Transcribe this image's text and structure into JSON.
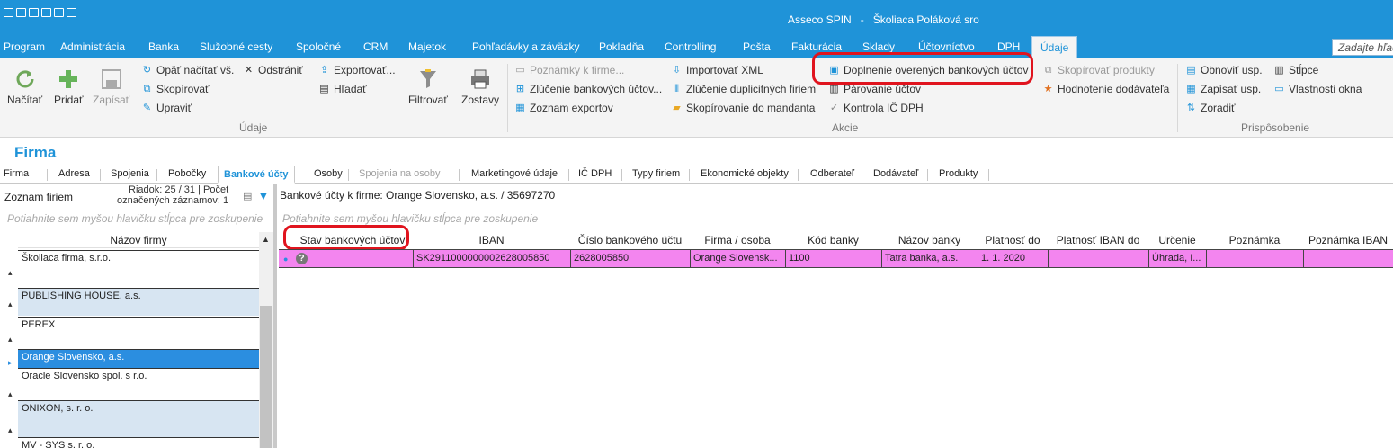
{
  "window": {
    "title": "Asseco SPIN   -   Školiaca Poláková sro"
  },
  "menu": {
    "items": [
      "Program",
      "Administrácia",
      "Banka",
      "Služobné cesty",
      "Spoločné",
      "CRM",
      "Majetok",
      "Pohľadávky a záväzky",
      "Pokladňa",
      "Controlling",
      "Pošta",
      "Fakturácia",
      "Sklady",
      "Účtovníctvo",
      "DPH"
    ],
    "active": "Údaje",
    "search_placeholder": "Zadajte hľad"
  },
  "ribbon": {
    "udaje": {
      "reload": "Načítať",
      "add": "Pridať",
      "save": "Zapísať",
      "reload_all": "Opäť načítať vš.",
      "remove": "Odstrániť",
      "copy": "Skopírovať",
      "edit": "Upraviť",
      "export": "Exportovať...",
      "find": "Hľadať",
      "filter": "Filtrovať",
      "reports": "Zostavy",
      "group": "Údaje"
    },
    "akcie": {
      "notes": "Poznámky k firme...",
      "merge_accounts": "Zlúčenie bankových účtov...",
      "export_list": "Zoznam exportov",
      "import_xml": "Importovať XML",
      "merge_duplicates": "Zlúčenie duplicitných firiem",
      "copy_to_mandant": "Skopírovanie do mandanta",
      "verified_accounts": "Doplnenie overených bankových účtov",
      "pair_accounts": "Párovanie účtov",
      "check_vat": "Kontrola IČ DPH",
      "copy_products": "Skopírovať produkty",
      "supplier_rating": "Hodnotenie dodávateľa",
      "group": "Akcie"
    },
    "prisposobenie": {
      "refresh": "Obnoviť usp.",
      "columns": "Stĺpce",
      "save_layout": "Zapísať usp.",
      "window_props": "Vlastnosti okna",
      "sort": "Zoradiť",
      "group": "Prispôsobenie"
    }
  },
  "form": {
    "title": "Firma",
    "tabs": [
      "Firma",
      "Adresa",
      "Spojenia",
      "Pobočky",
      "Bankové účty",
      "Osoby",
      "Spojenia na osoby",
      "Marketingové údaje",
      "IČ DPH",
      "Typy firiem",
      "Ekonomické objekty",
      "Odberateľ",
      "Dodávateľ",
      "Produkty"
    ],
    "active_tab": "Bankové účty"
  },
  "left": {
    "title": "Zoznam firiem",
    "row_info_1": "Riadok: 25 / 31 | Počet",
    "row_info_2": "označených záznamov: 1",
    "group_hint": "Potiahnite sem myšou hlavičku stĺpca pre zoskupenie",
    "column": "Názov firmy",
    "items": [
      "Školiaca firma, s.r.o.",
      "PUBLISHING HOUSE, a.s.",
      "PEREX",
      "Orange Slovensko, a.s.",
      "Oracle Slovensko spol. s r.o.",
      "ONIXON, s. r. o.",
      "MV - SYS s. r. o."
    ],
    "selected_index": 3
  },
  "right": {
    "title": "Bankové účty k firme: Orange Slovensko, a.s. / 35697270",
    "group_hint": "Potiahnite sem myšou hlavičku stĺpca pre zoskupenie",
    "columns": [
      "Stav bankových účtov",
      "IBAN",
      "Číslo bankového účtu",
      "Firma / osoba",
      "Kód banky",
      "Názov banky",
      "Platnosť do",
      "Platnosť IBAN do",
      "Určenie",
      "Poznámka",
      "Poznámka IBAN"
    ],
    "row": {
      "status_icon": "question-icon",
      "iban": "SK2911000000002628005850",
      "account": "2628005850",
      "entity": "Orange Slovensk...",
      "bank_code": "1100",
      "bank_name": "Tatra banka, a.s.",
      "valid_to": "1. 1. 2020",
      "iban_valid_to": "",
      "purpose": "Úhrada, I...",
      "note": "",
      "iban_note": ""
    }
  },
  "colors": {
    "accent": "#1f93d8",
    "row_highlight": "#f385ef",
    "selection": "#2b8ee0",
    "annotation": "#e0141e"
  }
}
